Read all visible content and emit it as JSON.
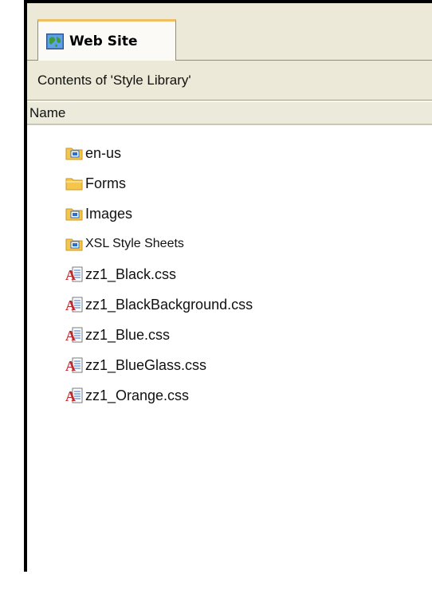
{
  "tab": {
    "label": "Web Site",
    "icon": "globe-icon"
  },
  "title_bar": {
    "text": "Contents of 'Style Library'"
  },
  "columns": [
    {
      "label": "Name"
    }
  ],
  "items": [
    {
      "name": "en-us",
      "type": "library-folder",
      "icon": "library-folder-icon"
    },
    {
      "name": "Forms",
      "type": "folder",
      "icon": "folder-icon"
    },
    {
      "name": "Images",
      "type": "library-folder",
      "icon": "library-folder-icon"
    },
    {
      "name": "XSL Style Sheets",
      "type": "library-folder",
      "icon": "library-folder-icon"
    },
    {
      "name": "zz1_Black.css",
      "type": "css-file",
      "icon": "css-file-icon"
    },
    {
      "name": "zz1_BlackBackground.css",
      "type": "css-file",
      "icon": "css-file-icon"
    },
    {
      "name": "zz1_Blue.css",
      "type": "css-file",
      "icon": "css-file-icon"
    },
    {
      "name": "zz1_BlueGlass.css",
      "type": "css-file",
      "icon": "css-file-icon"
    },
    {
      "name": "zz1_Orange.css",
      "type": "css-file",
      "icon": "css-file-icon"
    }
  ],
  "colors": {
    "chrome": "#ece9d8",
    "folder_yellow": "#f6c64a",
    "library_badge": "#2a6fcf",
    "css_red": "#c0282d"
  }
}
